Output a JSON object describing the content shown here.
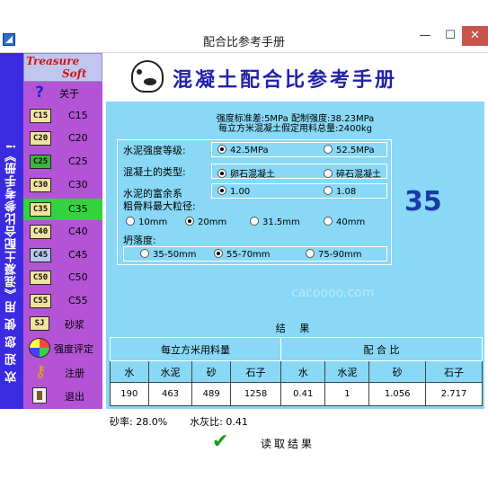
{
  "window": {
    "title": "配合比参考手册",
    "minimize": "—",
    "maximize": "☐",
    "close": "✕"
  },
  "banner": "欢 迎 您 使 用《混凝土配合比参考手册》!",
  "logo": {
    "line1": "Treasure",
    "line2": "Soft"
  },
  "sidebar": {
    "items": [
      {
        "icon": "question-icon",
        "code": "",
        "label": "关于"
      },
      {
        "icon": "c15-icon",
        "code": "C15",
        "label": "C15"
      },
      {
        "icon": "c20-icon",
        "code": "C20",
        "label": "C20"
      },
      {
        "icon": "c25-icon",
        "code": "C25",
        "label": "C25"
      },
      {
        "icon": "c30-icon",
        "code": "C30",
        "label": "C30"
      },
      {
        "icon": "c35-icon",
        "code": "C35",
        "label": "C35",
        "selected": true
      },
      {
        "icon": "c40-icon",
        "code": "C40",
        "label": "C40"
      },
      {
        "icon": "c45-icon",
        "code": "C45",
        "label": "C45"
      },
      {
        "icon": "c50-icon",
        "code": "C50",
        "label": "C50"
      },
      {
        "icon": "c55-icon",
        "code": "C55",
        "label": "C55"
      },
      {
        "icon": "sj-icon",
        "code": "SJ",
        "label": "砂浆"
      },
      {
        "icon": "pie-chart-icon",
        "code": "",
        "label": "强度评定"
      },
      {
        "icon": "key-icon",
        "code": "",
        "label": "注册"
      },
      {
        "icon": "exit-door-icon",
        "code": "",
        "label": "退出"
      }
    ]
  },
  "heading": "混凝土配合比参考手册",
  "info": {
    "line1": "强度标准差:5MPa 配制强度:38.23MPa",
    "line2": "每立方米混凝土假定用料总量:2400kg"
  },
  "form": {
    "cement_grade": {
      "label": "水泥强度等级:",
      "options": [
        "42.5MPa",
        "52.5MPa"
      ],
      "selected": 0
    },
    "concrete_type": {
      "label": "混凝土的类型:",
      "options": [
        "卵石混凝土",
        "碎石混凝土"
      ],
      "selected": 0
    },
    "cement_richness": {
      "label": "水泥的富余系",
      "options": [
        "1.00",
        "1.08"
      ],
      "selected": 0
    },
    "aggregate_size": {
      "label": "粗骨料最大粒径:",
      "options": [
        "10mm",
        "20mm",
        "31.5mm",
        "40mm"
      ],
      "selected": 1
    },
    "slump": {
      "label": "坍落度:",
      "options": [
        "35-50mm",
        "55-70mm",
        "75-90mm"
      ],
      "selected": 1
    }
  },
  "grade_display": "35",
  "watermark": "cacoooo.com",
  "results": {
    "title": "结 果",
    "group1": "每立方米用料量",
    "group2": "配 合 比",
    "headers": [
      "水",
      "水泥",
      "砂",
      "石子",
      "水",
      "水泥",
      "砂",
      "石子"
    ],
    "values": [
      "190",
      "463",
      "489",
      "1258",
      "0.41",
      "1",
      "1.056",
      "2.717"
    ]
  },
  "footer": {
    "sand_ratio": "砂率: 28.0%",
    "wc_ratio": "水灰比: 0.41",
    "read_button": "读取结果"
  }
}
